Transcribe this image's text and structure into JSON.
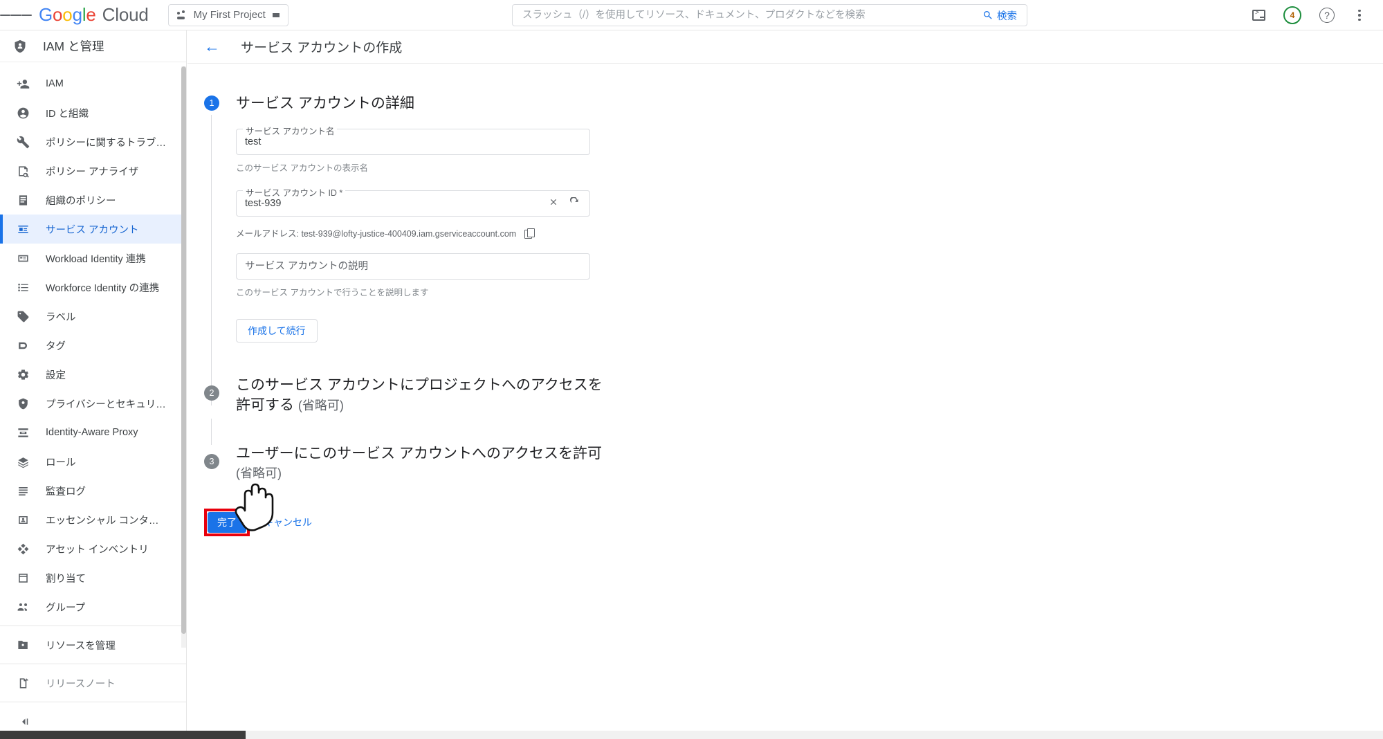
{
  "topbar": {
    "brand": {
      "g1": "G",
      "o1": "o",
      "o2": "o",
      "g2": "g",
      "l1": "l",
      "e1": "e",
      "cloud": "Cloud"
    },
    "project_selector": {
      "label": "My First Project",
      "icon": "project-dots-icon"
    },
    "search": {
      "placeholder": "スラッシュ（/）を使用してリソース、ドキュメント、プロダクトなどを検索",
      "value": "",
      "button_label": "検索",
      "button_icon": "search-icon"
    },
    "icons": {
      "cloud_shell": "terminal-icon",
      "notifications": {
        "icon": "notification-circle-icon",
        "count": "4",
        "ring_color": "#1e8e3e",
        "text_color": "#b06000"
      },
      "help": "help-circle-icon",
      "more": "more-vert-icon"
    }
  },
  "sidebar": {
    "header": {
      "icon": "iam-shield-icon",
      "title": "IAM と管理"
    },
    "items": [
      {
        "label": "IAM",
        "icon": "person-add-icon",
        "active": false
      },
      {
        "label": "ID と組織",
        "icon": "account-circle-icon",
        "active": false
      },
      {
        "label": "ポリシーに関するトラブ…",
        "icon": "wrench-icon",
        "active": false
      },
      {
        "label": "ポリシー アナライザ",
        "icon": "policy-analyzer-icon",
        "active": false
      },
      {
        "label": "組織のポリシー",
        "icon": "article-icon",
        "active": false
      },
      {
        "label": "サービス アカウント",
        "icon": "key-badge-icon",
        "active": true
      },
      {
        "label": "Workload Identity 連携",
        "icon": "badge-card-icon",
        "active": false
      },
      {
        "label": "Workforce Identity の連携",
        "icon": "list-icon",
        "active": false
      },
      {
        "label": "ラベル",
        "icon": "label-tag-icon",
        "active": false
      },
      {
        "label": "タグ",
        "icon": "tag-icon",
        "active": false
      },
      {
        "label": "設定",
        "icon": "gear-icon",
        "active": false
      },
      {
        "label": "プライバシーとセキュリ…",
        "icon": "shield-check-icon",
        "active": false
      },
      {
        "label": "Identity-Aware Proxy",
        "icon": "iap-icon",
        "active": false
      },
      {
        "label": "ロール",
        "icon": "roles-icon",
        "active": false
      },
      {
        "label": "監査ログ",
        "icon": "audit-log-icon",
        "active": false
      },
      {
        "label": "エッセンシャル コンタク…",
        "icon": "contacts-icon",
        "active": false
      },
      {
        "label": "アセット インベントリ",
        "icon": "asset-inventory-icon",
        "active": false
      },
      {
        "label": "割り当て",
        "icon": "quota-icon",
        "active": false
      },
      {
        "label": "グループ",
        "icon": "groups-icon",
        "active": false
      }
    ],
    "manage_resources": {
      "label": "リソースを管理",
      "icon": "folder-manage-icon"
    },
    "release_notes": {
      "label": "リリースノート",
      "icon": "release-notes-icon"
    },
    "collapse": {
      "icon": "collapse-panel-icon"
    }
  },
  "page": {
    "back_icon": "back-arrow-icon",
    "title": "サービス アカウントの作成"
  },
  "steps": [
    {
      "number": "1",
      "title": "サービス アカウントの詳細",
      "fields": {
        "name": {
          "floating_label": "サービス アカウント名",
          "value": "test",
          "placeholder": "",
          "hint": "このサービス アカウントの表示名"
        },
        "account_id": {
          "floating_label": "サービス アカウント ID *",
          "value": "test-939",
          "placeholder": "",
          "clear_icon": "close-icon",
          "refresh_icon": "refresh-icon"
        },
        "email": {
          "text": "メールアドレス: test-939@lofty-justice-400409.iam.gserviceaccount.com",
          "copy_icon": "copy-icon"
        },
        "description": {
          "placeholder": "サービス アカウントの説明",
          "value": "",
          "hint": "このサービス アカウントで行うことを説明します"
        }
      },
      "button": {
        "label": "作成して続行"
      }
    },
    {
      "number": "2",
      "title": "このサービス アカウントにプロジェクトへのアクセスを許可する",
      "optional": "(省略可)"
    },
    {
      "number": "3",
      "title": "ユーザーにこのサービス アカウントへのアクセスを許可",
      "optional": "(省略可)"
    }
  ],
  "actions": {
    "done": {
      "label": "完了",
      "highlighted": true,
      "highlight_color": "#e8000d",
      "bg_color": "#1a73e8"
    },
    "cancel": {
      "label": "キャンセル"
    }
  },
  "cursor": {
    "icon": "hand-pointer-icon"
  }
}
